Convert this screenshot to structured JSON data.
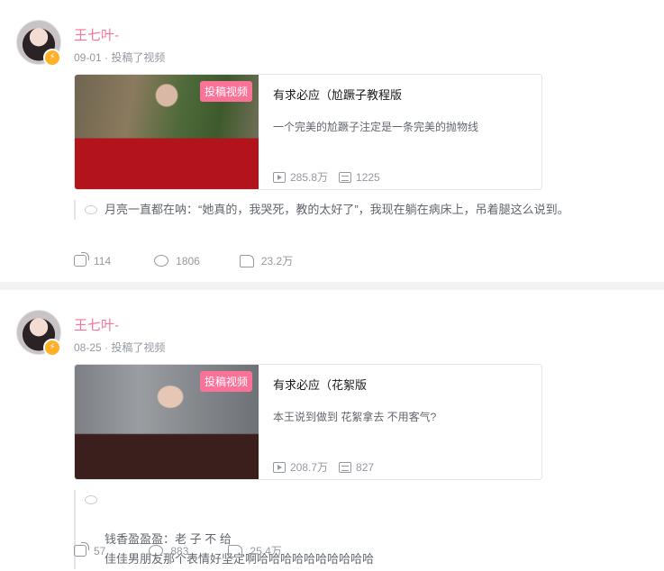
{
  "posts": [
    {
      "author": "王七叶-",
      "meta": "09-01 · 投稿了视频",
      "video": {
        "tag": "投稿视频",
        "title": "有求必应（尬蹶子教程版",
        "desc": "一个完美的尬蹶子注定是一条完美的抛物线",
        "plays": "285.8万",
        "danmaku": "1225"
      },
      "comment": {
        "user": "月亮一直都在呐：",
        "text": "“她真的，我哭死，教的太好了”，我现在躺在病床上，吊着腿这么说到。"
      },
      "actions": {
        "share": "114",
        "comments": "1806",
        "likes": "23.2万"
      }
    },
    {
      "author": "王七叶-",
      "meta": "08-25 · 投稿了视频",
      "video": {
        "tag": "投稿视频",
        "title": "有求必应（花絮版",
        "desc": "本王说到做到 花絮拿去 不用客气?",
        "plays": "208.7万",
        "danmaku": "827"
      },
      "comment": {
        "user": "钱香盈盈盈：",
        "text": "老 子 不 给\n佳佳男朋友那个表情好坚定啊哈哈哈哈哈哈哈哈哈哈"
      },
      "actions": {
        "share": "57",
        "comments": "883",
        "likes": "25.4万"
      }
    }
  ],
  "colors": {
    "accent": "#fb7299",
    "muted": "#9499a0",
    "badge": "#ffb027"
  },
  "icons": [
    "play-icon",
    "danmaku-icon",
    "share-icon",
    "comment-icon",
    "like-icon",
    "verified-badge-icon"
  ]
}
